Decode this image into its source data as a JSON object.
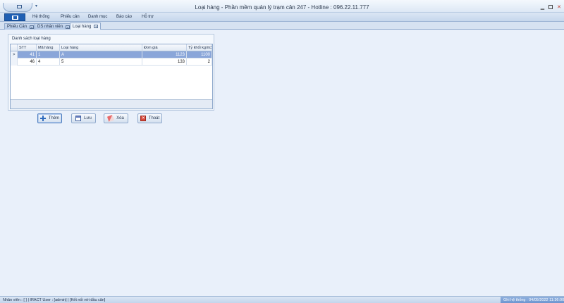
{
  "window": {
    "title": "Loại hàng - Phần mềm quản lý trạm cân 247 - Hotline : 096.22.11.777",
    "quick_access_arrow": "▾"
  },
  "menu": {
    "items": [
      "Hệ thống",
      "Phiếu cân",
      "Danh mục",
      "Báo cáo",
      "Hỗ trợ"
    ]
  },
  "tabs": [
    {
      "label": "Phiếu Cân",
      "active": false
    },
    {
      "label": "DS nhân viên",
      "active": false
    },
    {
      "label": "Loại hàng",
      "active": true
    }
  ],
  "group": {
    "title": "Danh sách loại hàng"
  },
  "grid": {
    "columns": [
      "STT",
      "Mã hàng",
      "Loại hàng",
      "Đơn giá",
      "Tỷ khối kg/m3"
    ],
    "rows": [
      {
        "indicator": ">",
        "stt": "41",
        "ma_hang": "1",
        "loai_hang": "A",
        "don_gia": "1123",
        "ty_khoi": "1100",
        "selected": true
      },
      {
        "indicator": "",
        "stt": "46",
        "ma_hang": "4",
        "loai_hang": "5",
        "don_gia": "133",
        "ty_khoi": "2",
        "selected": false
      }
    ]
  },
  "buttons": {
    "add": "Thêm",
    "save": "Lưu",
    "delete": "Xóa",
    "exit": "Thoát"
  },
  "status": {
    "left": "Nhân viên : [ ] | IRACT User : [admin] | [Kết nối với đầu cân]",
    "right": "Ghi hệ thống : 04/05/2022 11:36:00"
  },
  "icons": {
    "app": "grid-icon",
    "add": "plus-icon",
    "save": "calendar-icon",
    "delete": "eraser-icon",
    "exit": "exit-icon"
  }
}
